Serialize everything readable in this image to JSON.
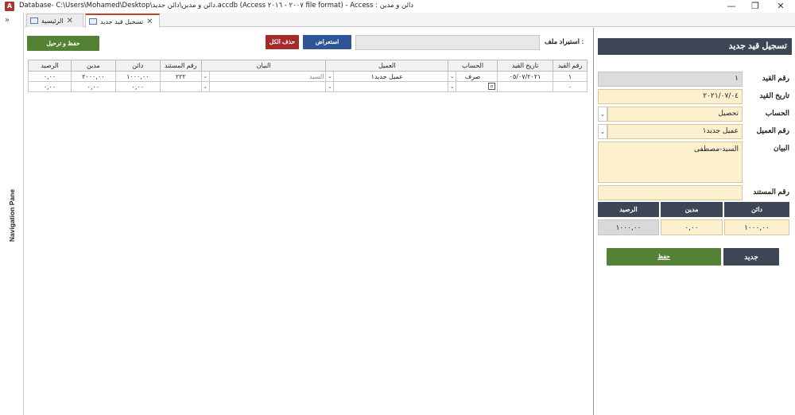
{
  "titlebar": {
    "title": "Database- C:\\Users\\Mohamed\\Desktop\\دائن و مدين\\دائن جديد.accdb (Access ٢٠٠٧ - ٢٠١٦ file format) - Access : دائن و مدين",
    "app_icon": "A"
  },
  "nav": {
    "label": "Navigation Pane",
    "toggle": "»"
  },
  "tabs": [
    {
      "label": "الرئيسية"
    },
    {
      "label": "تسجيل قيد جديد"
    }
  ],
  "toolbar": {
    "save_post_label": "حفظ و ترحيل",
    "delete_all_label": "حذف الكل",
    "browse_label": "استعراض",
    "import_label": "استيراد ملف :",
    "import_value": ""
  },
  "grid": {
    "headers": [
      "رقم القيد",
      "تاريخ القيد",
      "الحساب",
      "العميل",
      "البيان",
      "رقم المستند",
      "دائن",
      "مدين",
      "الرصيد"
    ],
    "rows": [
      {
        "no": "١",
        "date": "٠٥/٠٧/٢٠٢١",
        "account": "صرف",
        "client": "عميل جديد١",
        "statement": "السيد",
        "doc": "٢٢٢",
        "credit": "١٠٠٠,٠٠",
        "debit": "٢٠٠٠,٠٠",
        "balance": "٠,٠٠"
      },
      {
        "no": "٠",
        "date": "",
        "account": "",
        "client": "",
        "statement": "",
        "doc": "",
        "credit": "٠,٠٠",
        "debit": "٠,٠٠",
        "balance": "٠,٠٠"
      }
    ]
  },
  "form": {
    "header": "تسجيل قيد جديد",
    "entry_no_label": "رقم القيد",
    "entry_no": "١",
    "entry_date_label": "تاريخ القيد",
    "entry_date": "٢٠٢١/٠٧/٠٤",
    "account_label": "الحساب",
    "account": "تحصيل",
    "client_label": "رقم العميل",
    "client": "عميل جديد١",
    "statement_label": "البيان",
    "statement": "السيد-مصطفى",
    "doc_no_label": "رقم المستند",
    "doc_no": "",
    "sum_headers": {
      "credit": "دائن",
      "debit": "مدين",
      "balance": "الرصيد"
    },
    "sums": {
      "credit": "١٠٠٠,٠٠",
      "debit": "٠,٠٠",
      "balance": "١٠٠٠,٠٠"
    },
    "new_label": "جديد",
    "save_label": "حفظ"
  },
  "colors": {
    "accent_red": "#b7472a",
    "header_dark": "#3d4654",
    "green": "#548235",
    "blue_btn": "#2f5597",
    "red_btn": "#a52a2a",
    "field_yellow": "#fdf0cf"
  }
}
